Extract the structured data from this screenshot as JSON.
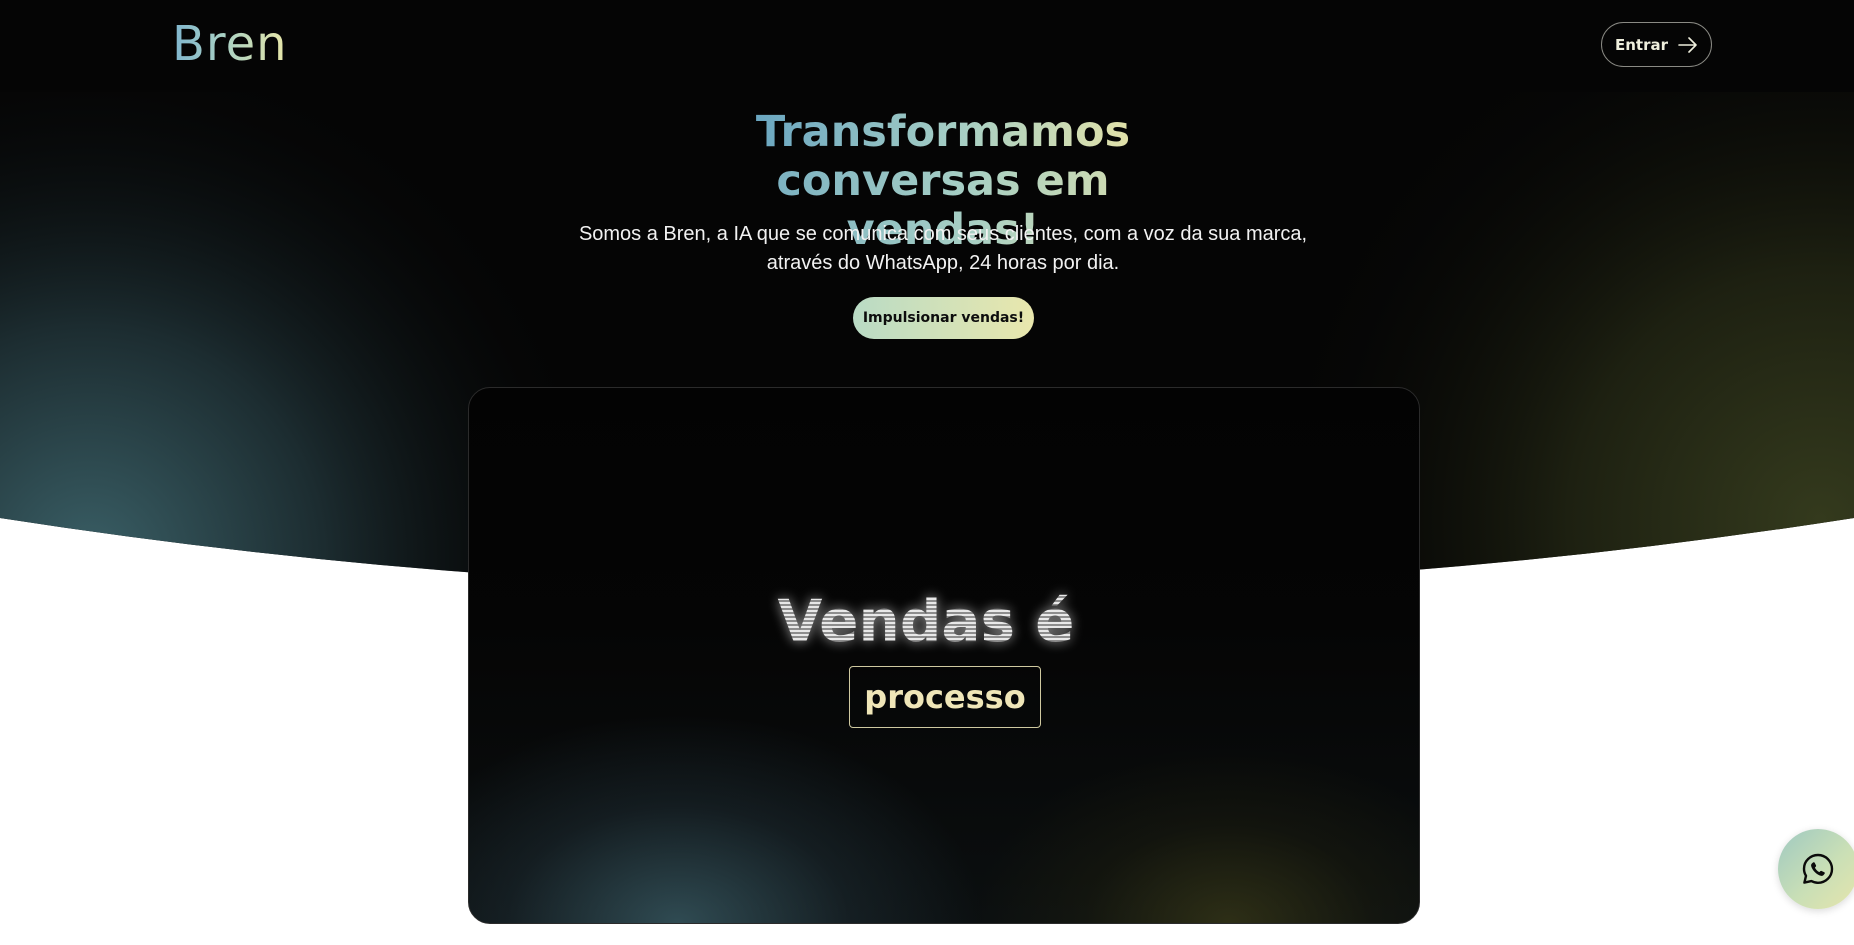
{
  "header": {
    "logo_text": "Bren",
    "login_label": "Entrar"
  },
  "hero": {
    "title_line1": "Transformamos",
    "title_line2": "conversas em vendas!",
    "subtitle_line1": "Somos a Bren, a IA que se comunica com seus clientes, com a voz da sua marca,",
    "subtitle_line2": "através do WhatsApp, 24 horas por dia.",
    "cta_label": "Impulsionar vendas!"
  },
  "video_card": {
    "headline": "Vendas é",
    "highlight_word": "processo"
  },
  "floating": {
    "whatsapp_icon": "whatsapp-icon"
  },
  "colors": {
    "header_bg": "#050505",
    "gradient_blue": "#6aa6c1",
    "gradient_yellow": "#e9e7ad",
    "hero_teal_glow": "#2f4f55",
    "hero_olive_glow": "#2c3218"
  }
}
